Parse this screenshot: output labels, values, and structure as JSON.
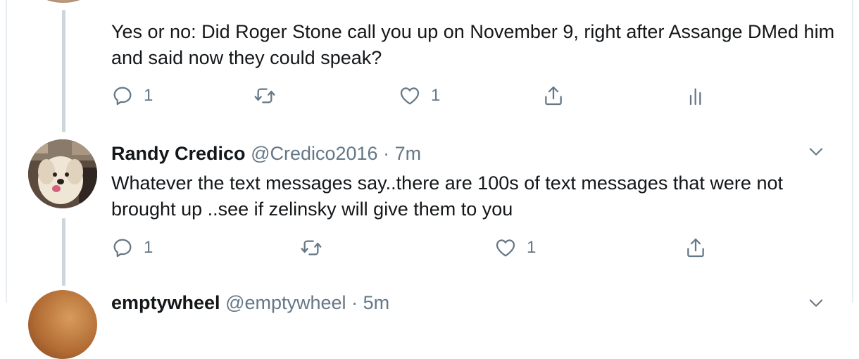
{
  "tweet1": {
    "text": "Yes or no: Did Roger Stone call you up on November 9, right after Assange DMed him and said now they could speak?",
    "reply_count": "1",
    "like_count": "1"
  },
  "tweet2": {
    "name": "Randy Credico",
    "handle": "@Credico2016",
    "separator": "·",
    "time": "7m",
    "text": "Whatever the text messages say..there are 100s of text messages that were not brought up ..see if zelinsky will give them to you",
    "reply_count": "1",
    "like_count": "1"
  },
  "tweet3": {
    "name": "emptywheel",
    "handle": "@emptywheel",
    "separator": "·",
    "time": "5m"
  },
  "icons": {
    "reply": "reply-icon",
    "retweet": "retweet-icon",
    "like": "heart-icon",
    "share": "share-icon",
    "analytics": "analytics-icon",
    "caret": "chevron-down-icon"
  },
  "colors": {
    "text": "#14171a",
    "muted": "#657786",
    "thread_line": "#ccd6dd"
  }
}
